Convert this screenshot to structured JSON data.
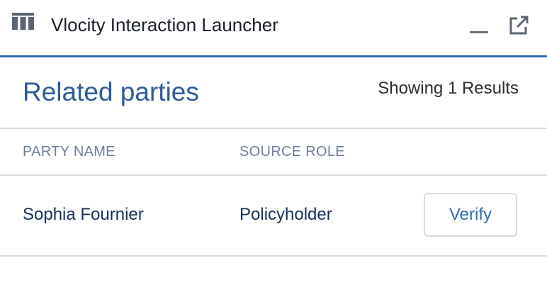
{
  "header": {
    "title": "Vlocity Interaction Launcher",
    "icons": {
      "app": "columns-icon",
      "minimize": "minimize-icon",
      "popout": "popout-icon"
    },
    "accent_color": "#2e6db4"
  },
  "section": {
    "title": "Related parties",
    "results_count": "Showing 1 Results"
  },
  "table": {
    "columns": [
      "PARTY NAME",
      "SOURCE ROLE"
    ],
    "rows": [
      {
        "party_name": "Sophia Fournier",
        "source_role": "Policyholder",
        "action_label": "Verify"
      }
    ]
  }
}
